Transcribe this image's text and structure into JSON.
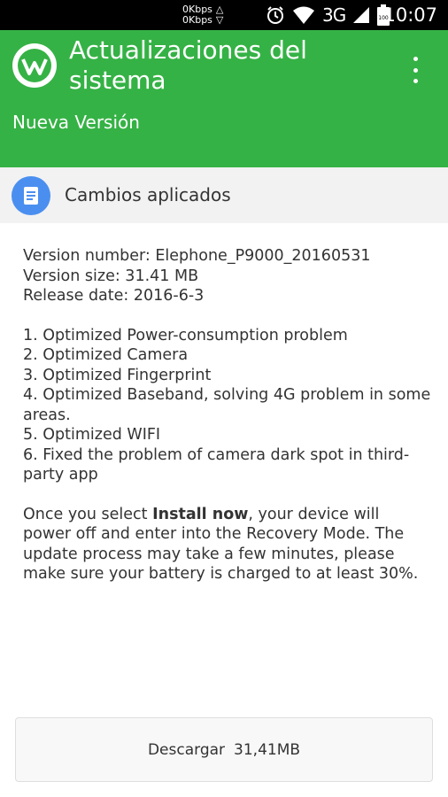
{
  "status_bar": {
    "upload_speed": "0Kbps",
    "download_speed": "0Kbps",
    "up_arrow": "△",
    "down_arrow": "▽",
    "network_type": "3G",
    "battery_level": "100",
    "time": "10:07",
    "icons": [
      "alarm-icon",
      "wifi-icon",
      "signal-icon",
      "battery-icon"
    ]
  },
  "header": {
    "title": "Actualizaciones del sistema",
    "subtitle": "Nueva Versión",
    "background_color": "#35b245"
  },
  "section": {
    "title": "Cambios aplicados",
    "icon": "document-icon",
    "icon_color": "#4a8ff0"
  },
  "details": {
    "version_number": "Version number: Elephone_P9000_20160531",
    "version_size": "Version size: 31.41 MB",
    "release_date": "Release date: 2016-6-3"
  },
  "changes": [
    "1. Optimized Power-consumption problem",
    "2. Optimized Camera",
    "3. Optimized Fingerprint",
    "4. Optimized Baseband, solving 4G problem in some areas.",
    "5. Optimized WIFI",
    "6. Fixed the problem of camera dark spot in third-party app"
  ],
  "notice": {
    "prefix": "Once you select ",
    "emphasis": "Install now",
    "suffix": ", your device will power off and enter into the Recovery Mode. The update process may take a few minutes, please make sure your battery is charged to at least 30%."
  },
  "download": {
    "label": "Descargar",
    "size": "31,41MB"
  }
}
